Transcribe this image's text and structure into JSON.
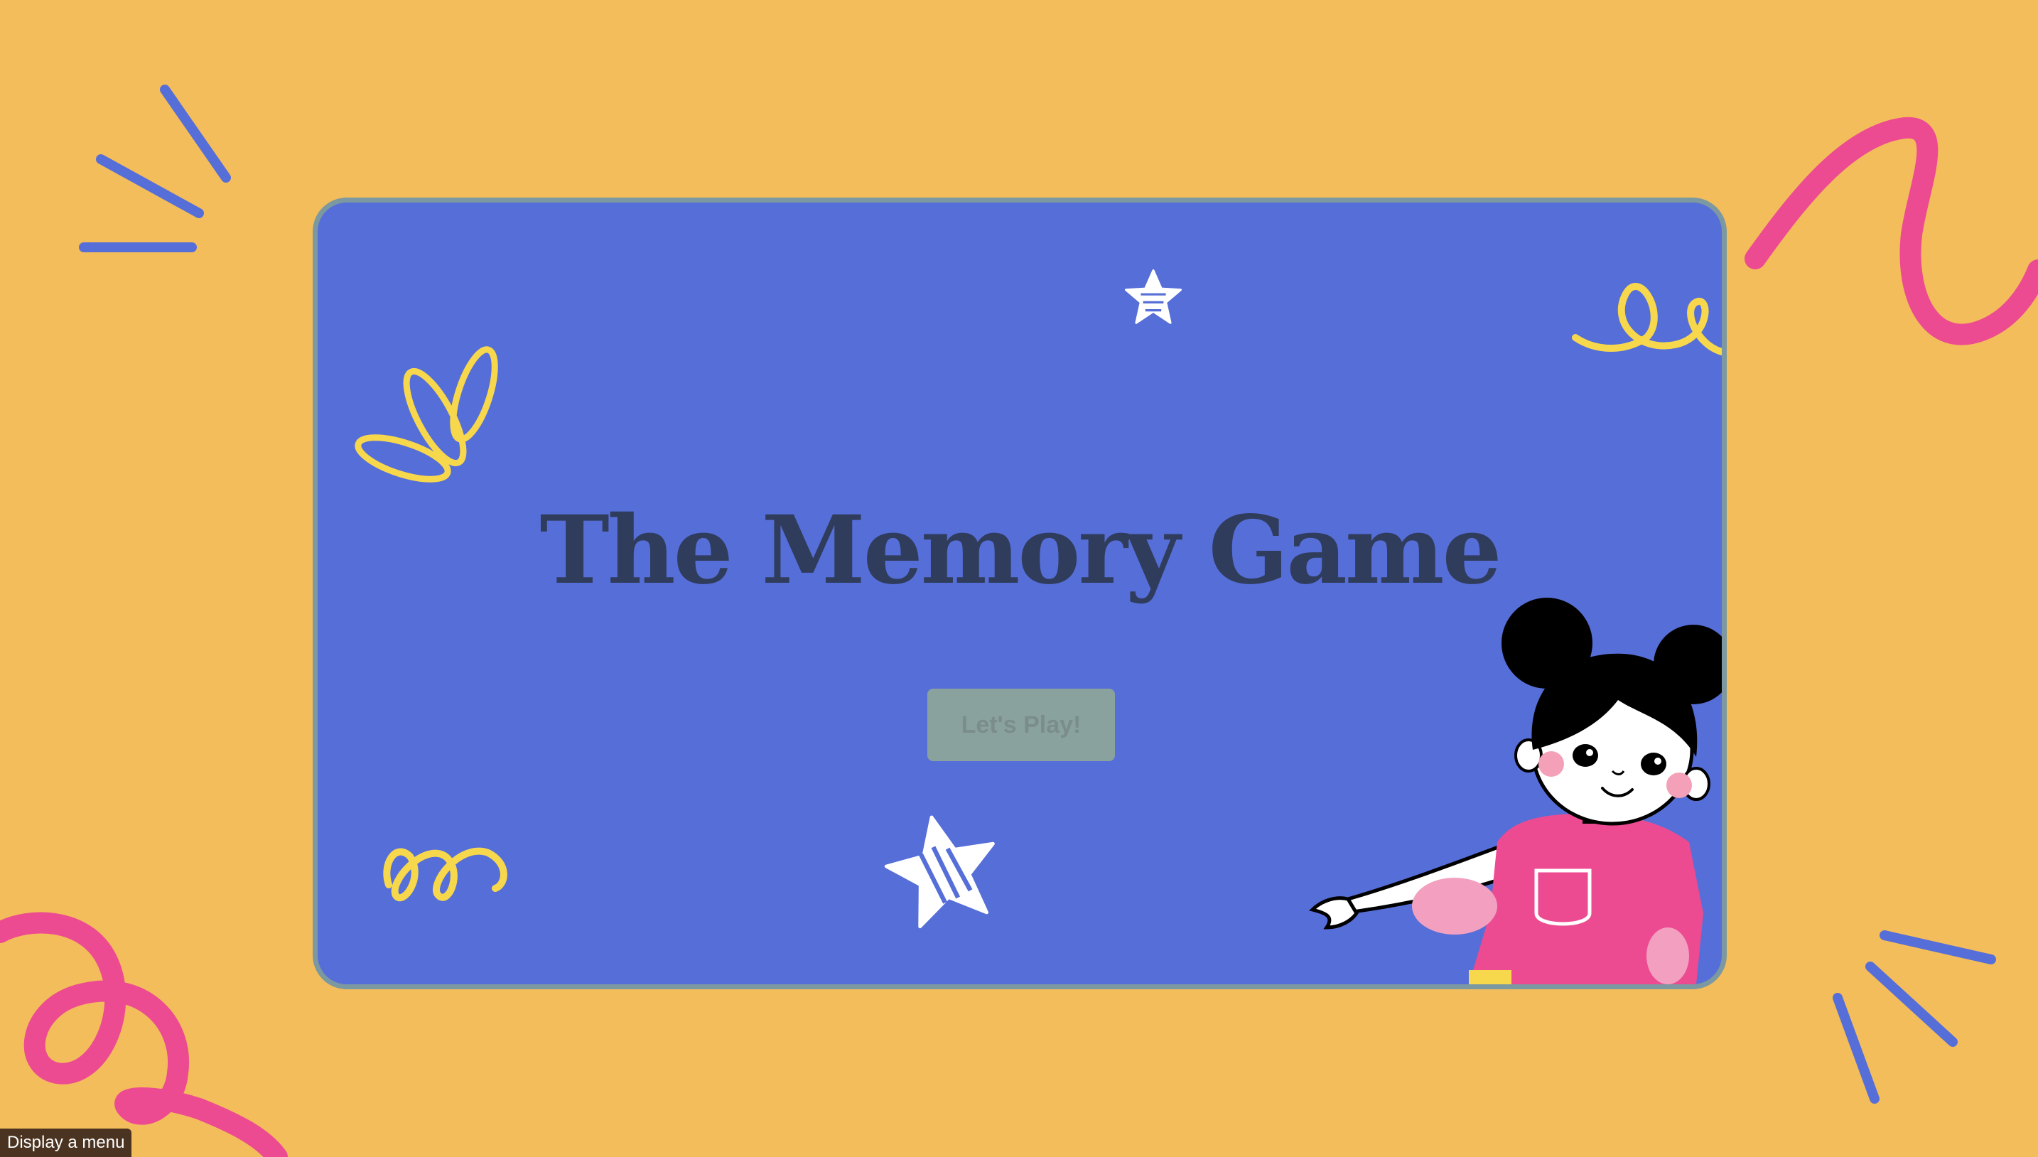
{
  "page": {
    "background_color": "#f4bd5c"
  },
  "card": {
    "background_color": "#566ed7",
    "border_color": "#7c98a0",
    "title": "The Memory Game",
    "play_button_label": "Let's Play!"
  },
  "status_tooltip": {
    "text": "Display a menu"
  },
  "decorations": {
    "accent_blue": "#566ed7",
    "accent_pink": "#ec4b91",
    "accent_yellow": "#f7d84c",
    "illustration": "girl-pointing"
  }
}
